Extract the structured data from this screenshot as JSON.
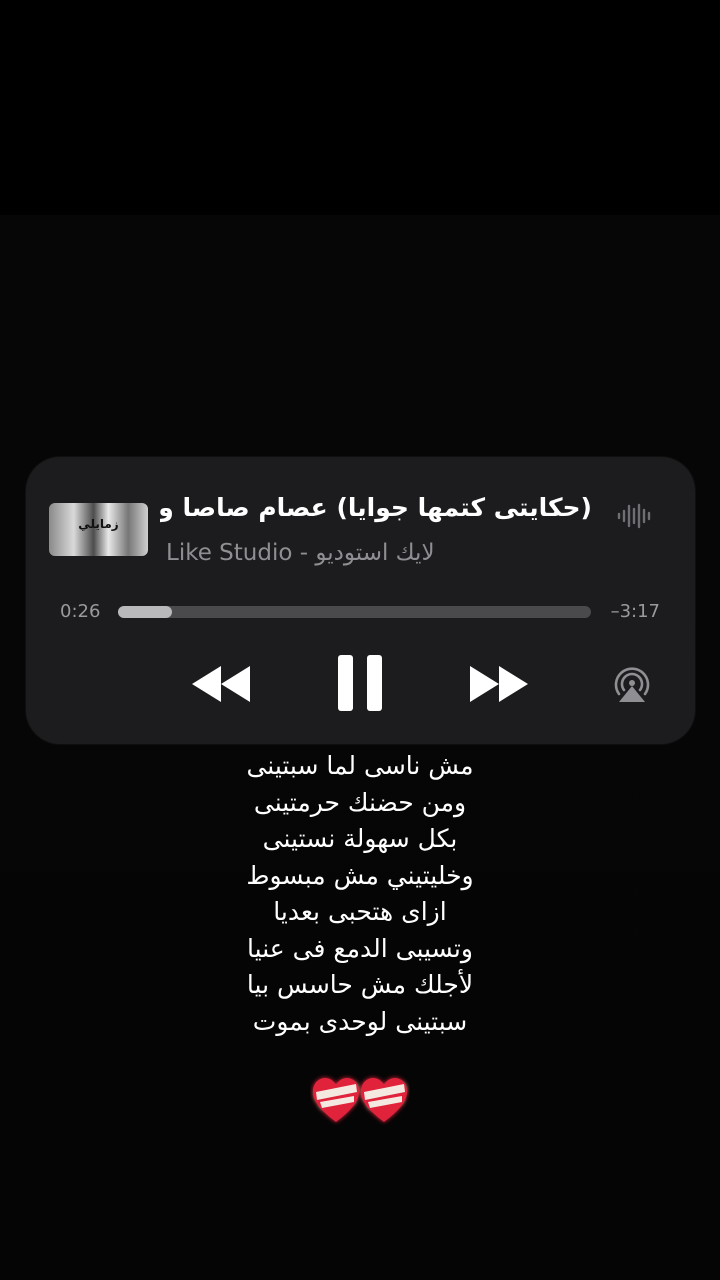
{
  "now_playing": {
    "title": "(حكايتى كتمها جوايا) عصام صاصا و مع",
    "artist": "Like Studio - لايك استوديو",
    "artwork_text": "زمايلي",
    "elapsed": "0:26",
    "remaining": "–3:17",
    "progress": 0.115,
    "icons": {
      "waveform": "waveform-icon",
      "rewind": "backward-icon",
      "pause": "pause-icon",
      "forward": "forward-icon",
      "airplay": "airplay-icon"
    }
  },
  "lyrics": [
    "مش ناسى لما سبتينى",
    "ومن حضنك حرمتينى",
    "بكل سهولة نستينى",
    "وخليتيني مش مبسوط",
    "ازاى هتحبى بعديا",
    "وتسيبى الدمع فى عنيا",
    "لأجلك مش حاسس بيا",
    "سبتينى لوحدى بموت"
  ],
  "decoration": "bandaged-heart-emoji",
  "colors": {
    "background": "#000000",
    "card": "#1c1c1e",
    "secondary_text": "#8e8e93",
    "progress_fill": "#b9b9bc",
    "progress_track": "#4a4a4d",
    "heart": "#e0213a"
  }
}
